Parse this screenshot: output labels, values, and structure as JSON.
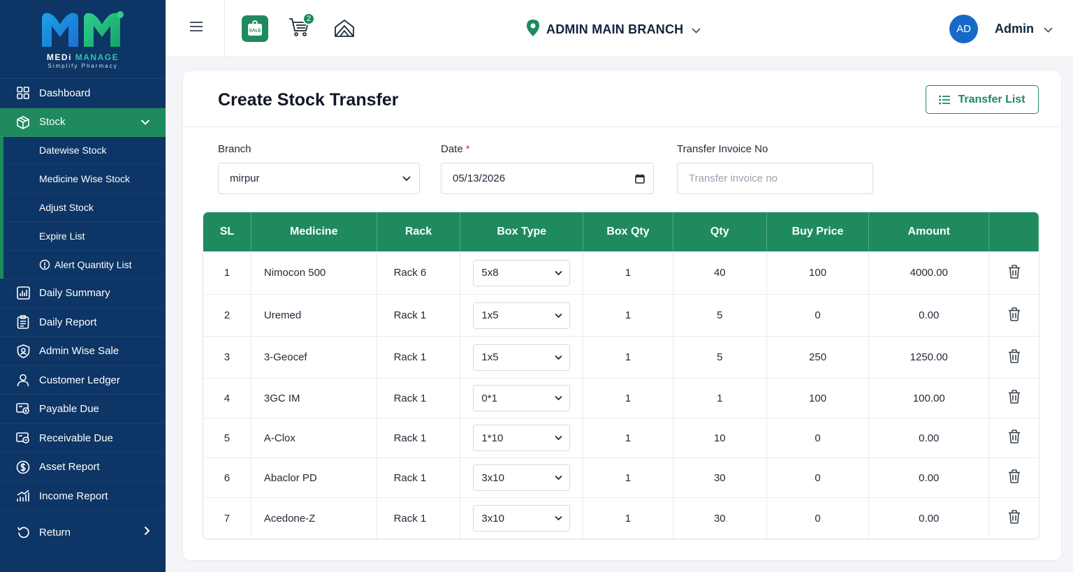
{
  "brand": {
    "name_part1": "MEDi",
    "name_part2": "MANAGE",
    "tagline": "Simplify Pharmacy"
  },
  "sidebar": {
    "items": [
      {
        "label": "Dashboard",
        "icon": "dashboard-icon"
      },
      {
        "label": "Stock",
        "icon": "box-icon",
        "active": true
      },
      {
        "label": "Daily Summary",
        "icon": "chart-icon"
      },
      {
        "label": "Daily Report",
        "icon": "clipboard-icon"
      },
      {
        "label": "Admin Wise Sale",
        "icon": "shield-user-icon"
      },
      {
        "label": "Customer Ledger",
        "icon": "user-icon"
      },
      {
        "label": "Payable Due",
        "icon": "payment-icon"
      },
      {
        "label": "Receivable Due",
        "icon": "payment-icon"
      },
      {
        "label": "Asset Report",
        "icon": "dollar-icon"
      },
      {
        "label": "Income Report",
        "icon": "bar-chart-icon"
      },
      {
        "label": "Return",
        "icon": "return-icon"
      }
    ],
    "stock_submenu": [
      {
        "label": "Datewise Stock"
      },
      {
        "label": "Medicine Wise Stock"
      },
      {
        "label": "Adjust Stock"
      },
      {
        "label": "Expire List"
      },
      {
        "label": "Alert Quantity List"
      }
    ]
  },
  "topbar": {
    "sale_label": "SALE",
    "cart_count": "2",
    "branch": "ADMIN MAIN BRANCH",
    "avatar_initials": "AD",
    "user": "Admin"
  },
  "page": {
    "title": "Create Stock Transfer",
    "transfer_list_label": "Transfer List"
  },
  "form": {
    "branch_label": "Branch",
    "branch_value": "mirpur",
    "date_label": "Date",
    "date_required": "*",
    "date_value": "05/13/2026",
    "invoice_label": "Transfer Invoice No",
    "invoice_placeholder": "Transfer invoice no"
  },
  "table": {
    "headers": [
      "SL",
      "Medicine",
      "Rack",
      "Box Type",
      "Box Qty",
      "Qty",
      "Buy Price",
      "Amount",
      ""
    ],
    "rows": [
      {
        "sl": "1",
        "medicine": "Nimocon 500",
        "rack": "Rack 6",
        "box_type": "5x8",
        "box_qty": "1",
        "qty": "40",
        "buy_price": "100",
        "amount": "4000.00"
      },
      {
        "sl": "2",
        "medicine": "Uremed",
        "rack": "Rack 1",
        "box_type": "1x5",
        "box_qty": "1",
        "qty": "5",
        "buy_price": "0",
        "amount": "0.00"
      },
      {
        "sl": "3",
        "medicine": "3-Geocef",
        "rack": "Rack 1",
        "box_type": "1x5",
        "box_qty": "1",
        "qty": "5",
        "buy_price": "250",
        "amount": "1250.00"
      },
      {
        "sl": "4",
        "medicine": "3GC IM",
        "rack": "Rack 1",
        "box_type": "0*1",
        "box_qty": "1",
        "qty": "1",
        "buy_price": "100",
        "amount": "100.00"
      },
      {
        "sl": "5",
        "medicine": "A-Clox",
        "rack": "Rack 1",
        "box_type": "1*10",
        "box_qty": "1",
        "qty": "10",
        "buy_price": "0",
        "amount": "0.00"
      },
      {
        "sl": "6",
        "medicine": "Abaclor PD",
        "rack": "Rack 1",
        "box_type": "3x10",
        "box_qty": "1",
        "qty": "30",
        "buy_price": "0",
        "amount": "0.00"
      },
      {
        "sl": "7",
        "medicine": "Acedone-Z",
        "rack": "Rack 1",
        "box_type": "3x10",
        "box_qty": "1",
        "qty": "30",
        "buy_price": "0",
        "amount": "0.00"
      }
    ]
  },
  "colors": {
    "sidebar_bg": "#0d3566",
    "accent_green": "#1e8a5e",
    "avatar_blue": "#1769c7"
  }
}
